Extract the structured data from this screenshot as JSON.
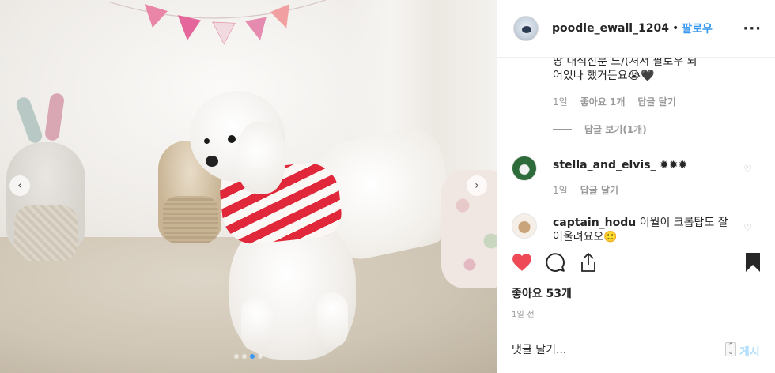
{
  "post": {
    "username": "poodle_ewall_1204",
    "separator": "•",
    "follow_label": "팔로우",
    "more_icon": "more-dots-icon"
  },
  "comments": {
    "caption_partial_line1": "땅 내석신분 느/(셔서 팔로우 되",
    "caption_partial_line2": "어있나 했거든요😭🖤",
    "caption_meta": {
      "time": "1일",
      "likes": "좋아요 1개",
      "reply": "답글 달기"
    },
    "view_replies": "답글 보기(1개)",
    "items": [
      {
        "username": "stella_and_elvis_",
        "text": "✹✹✹",
        "time": "1일",
        "reply": "답글 달기"
      },
      {
        "username": "captain_hodu",
        "text_line1": "이월이 크롭탑도 잘",
        "text_line2": "어울려요오🙂"
      }
    ]
  },
  "actions": {
    "like_icon": "heart-filled-icon",
    "comment_icon": "comment-bubble-icon",
    "share_icon": "share-icon",
    "save_icon": "bookmark-icon",
    "like_color": "#ed4956"
  },
  "likes": "좋아요 53개",
  "date": "1일 전",
  "comment_input": {
    "placeholder": "댓글 달기..."
  },
  "post_button": "게시",
  "carousel": {
    "count": 4,
    "active_index": 2
  }
}
